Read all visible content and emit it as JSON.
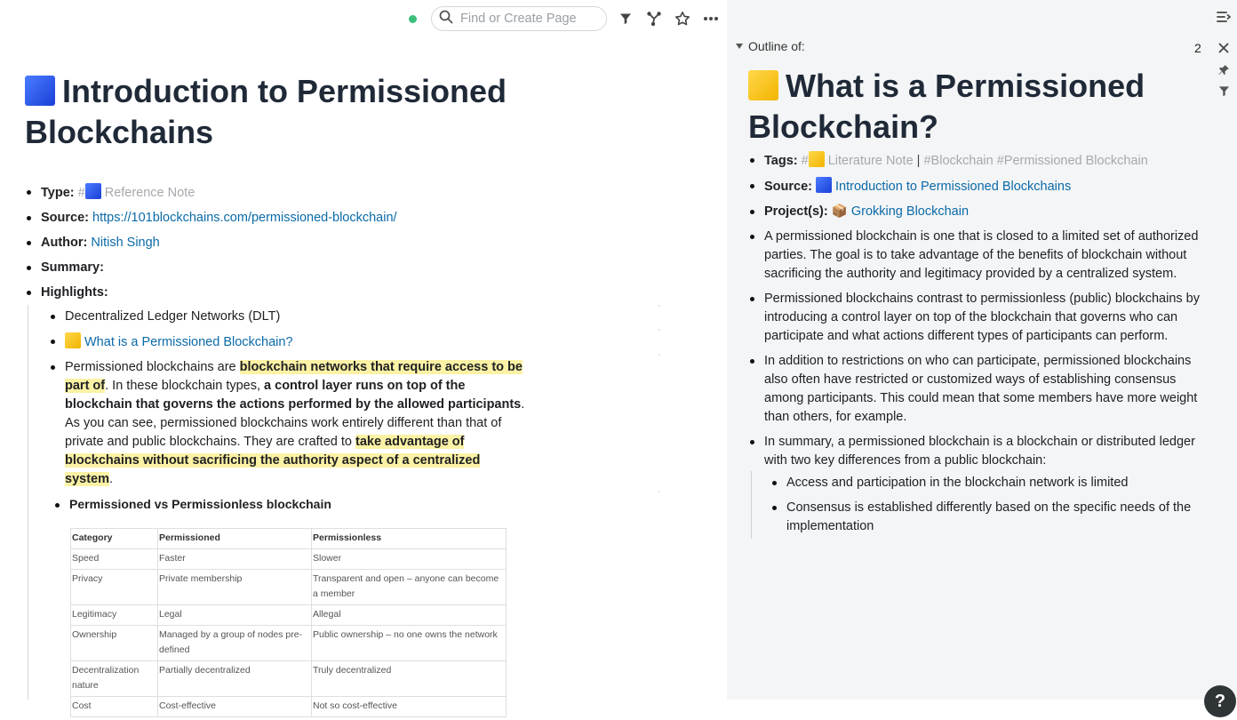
{
  "topbar": {
    "search_placeholder": "Find or Create Page"
  },
  "page": {
    "title": "Introduction to Permissioned Blockchains",
    "props": {
      "type_key": "Type:",
      "type_hash": "#",
      "type_value": "Reference Note",
      "source_key": "Source:",
      "source_value": "https://101blockchains.com/permissioned-blockchain/",
      "author_key": "Author:",
      "author_value": "Nitish Singh",
      "summary_key": "Summary:",
      "highlights_key": "Highlights:"
    },
    "children": {
      "dlt": "Decentralized Ledger Networks (DLT)",
      "link_page": "What is a Permissioned Blockchain?",
      "p_1": "Permissioned blockchains are ",
      "p_2": "blockchain networks that require access to be part of",
      "p_3": ". In these blockchain types, ",
      "p_4": "a control layer runs on top of the blockchain that governs the actions performed by the allowed participants",
      "p_5": ". As you can see, permissioned blockchains work entirely different than that of private and public blockchains. They are crafted to ",
      "p_6": "take  advantage of blockchains without sacrificing the authority aspect of a centralized system",
      "p_7": "."
    },
    "table": {
      "heading": "Permissioned vs Permissionless blockchain",
      "columns": [
        "Category",
        "Permissioned",
        "Permissionless"
      ],
      "rows": [
        [
          "Speed",
          "Faster",
          "Slower"
        ],
        [
          "Privacy",
          "Private membership",
          "Transparent and open – anyone can become a member"
        ],
        [
          "Legitimacy",
          "Legal",
          "Allegal"
        ],
        [
          "Ownership",
          "Managed by a group of nodes pre-defined",
          "Public ownership – no one owns the network"
        ],
        [
          "Decentralization nature",
          "Partially decentralized",
          "Truly decentralized"
        ],
        [
          "Cost",
          "Cost-effective",
          "Not so cost-effective"
        ]
      ]
    }
  },
  "sidebar": {
    "outline_label": "Outline of:",
    "count": "2",
    "title": "What is a Permissioned Blockchain?",
    "tags_key": "Tags:",
    "tag_hash": "#",
    "tag_literature": "Literature Note",
    "tag_sep": "|",
    "tag_blockchain": "#Blockchain",
    "tag_permissioned": "#Permissioned Blockchain",
    "source_key": "Source:",
    "source_value": "Introduction to Permissioned Blockchains",
    "project_key": "Project(s):",
    "project_emoji": "📦",
    "project_value": "Grokking Blockchain",
    "b1": "A permissioned blockchain is one that is closed to a limited set of authorized parties. The goal is to take advantage of the benefits of blockchain without sacrificing the authority and legitimacy provided by a centralized system.",
    "b2": "Permissioned blockchains contrast to permissionless (public) blockchains by introducing a control layer on top of the blockchain that governs who can participate and what actions different types of participants can perform.",
    "b3": "In addition to restrictions on who can participate, permissioned blockchains also often have restricted or customized ways of establishing consensus among participants. This could mean that some members have more weight than others, for example.",
    "b4": "In summary, a permissioned blockchain is a blockchain or distributed ledger with two key differences from a public blockchain:",
    "sub1": "Access and participation in the blockchain network is limited",
    "sub2": "Consensus is established differently based on the specific needs of the implementation"
  },
  "help": {
    "label": "?"
  },
  "colors": {
    "link": "#0b6aa8",
    "highlight": "#fbf2a5",
    "sync": "#3dbf7a",
    "sidebar_bg": "#f4f5f6"
  },
  "icons": [
    "search-icon",
    "filter-icon",
    "graph-icon",
    "star-icon",
    "more-icon",
    "sidebar-toggle-icon",
    "close-icon",
    "pin-icon",
    "caret-down-icon",
    "help-icon"
  ]
}
